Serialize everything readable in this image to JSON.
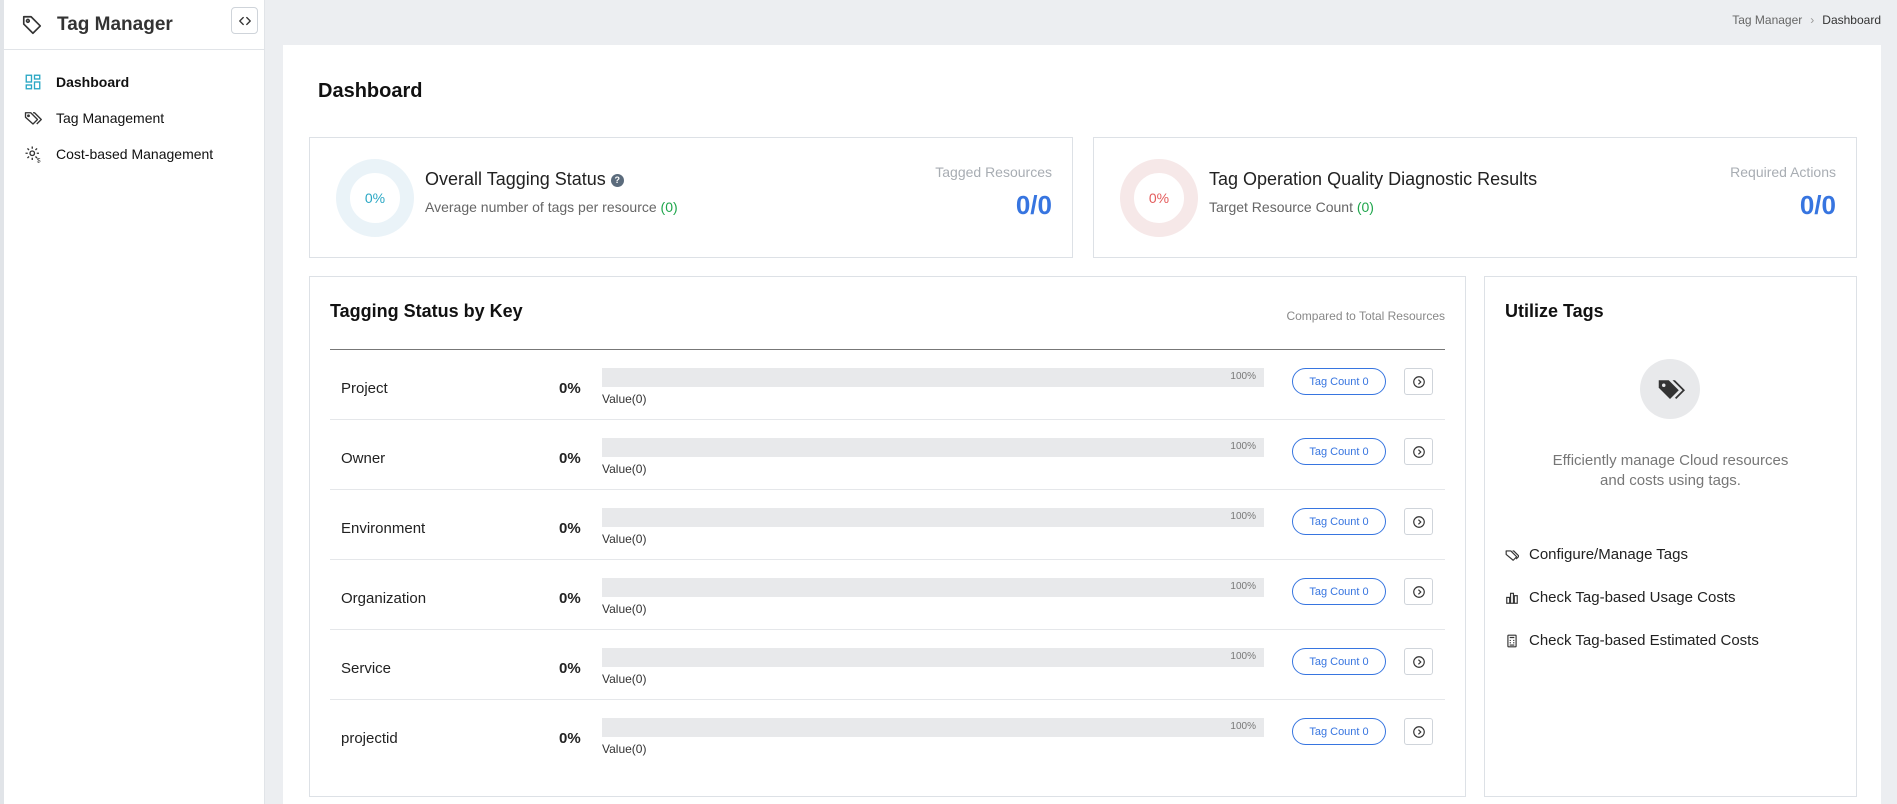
{
  "app": {
    "title": "Tag Manager"
  },
  "sidebar": {
    "items": [
      {
        "label": "Dashboard",
        "icon": "dashboard-icon",
        "active": true
      },
      {
        "label": "Tag Management",
        "icon": "tags-icon",
        "active": false
      },
      {
        "label": "Cost-based Management",
        "icon": "cost-settings-icon",
        "active": false
      }
    ]
  },
  "breadcrumb": {
    "parent": "Tag Manager",
    "current": "Dashboard"
  },
  "page": {
    "title": "Dashboard"
  },
  "overall": {
    "donut": "0%",
    "title": "Overall Tagging Status",
    "subtitle": "Average number of tags per resource",
    "subtitle_value": "(0)",
    "stat_label": "Tagged Resources",
    "stat_value": "0/0"
  },
  "quality": {
    "donut": "0%",
    "title": "Tag Operation Quality Diagnostic Results",
    "subtitle": "Target Resource Count",
    "subtitle_value": "(0)",
    "stat_label": "Required Actions",
    "stat_value": "0/0"
  },
  "tagging": {
    "title": "Tagging Status by Key",
    "compare": "Compared to Total Resources",
    "rows": [
      {
        "key": "Project",
        "pct": "0%",
        "fill": 0,
        "bar_label": "100%",
        "value": "Value(0)",
        "badge": "Tag Count 0"
      },
      {
        "key": "Owner",
        "pct": "0%",
        "fill": 0,
        "bar_label": "100%",
        "value": "Value(0)",
        "badge": "Tag Count 0"
      },
      {
        "key": "Environment",
        "pct": "0%",
        "fill": 0,
        "bar_label": "100%",
        "value": "Value(0)",
        "badge": "Tag Count 0"
      },
      {
        "key": "Organization",
        "pct": "0%",
        "fill": 0,
        "bar_label": "100%",
        "value": "Value(0)",
        "badge": "Tag Count 0"
      },
      {
        "key": "Service",
        "pct": "0%",
        "fill": 0,
        "bar_label": "100%",
        "value": "Value(0)",
        "badge": "Tag Count 0"
      },
      {
        "key": "projectid",
        "pct": "0%",
        "fill": 0,
        "bar_label": "100%",
        "value": "Value(0)",
        "badge": "Tag Count 0"
      }
    ]
  },
  "utilize": {
    "title": "Utilize Tags",
    "desc_line1": "Efficiently manage Cloud resources",
    "desc_line2": "and costs using tags.",
    "links": [
      {
        "label": "Configure/Manage Tags",
        "icon": "tag-icon"
      },
      {
        "label": "Check Tag-based Usage Costs",
        "icon": "bar-chart-icon"
      },
      {
        "label": "Check Tag-based Estimated Costs",
        "icon": "calculator-icon"
      }
    ]
  },
  "colors": {
    "accent": "#3775e0",
    "teal": "#2aa7c4",
    "red": "#e35b5b",
    "green": "#1fa64c"
  }
}
